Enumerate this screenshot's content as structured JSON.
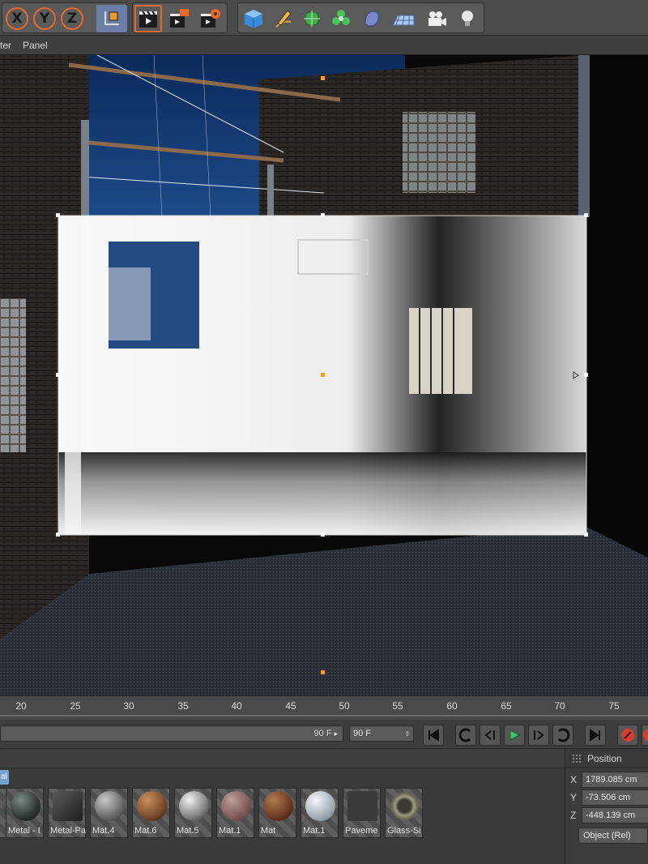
{
  "toolbar": {
    "axis_buttons": [
      "X",
      "Y",
      "Z"
    ],
    "icons": [
      "coordinate-system-icon",
      "render-view-icon",
      "render-to-picture-viewer-icon",
      "render-settings-icon",
      "cube-primitive-icon",
      "pen-spline-icon",
      "subdivision-icon",
      "cloner-icon",
      "deformer-icon",
      "floor-scene-icon",
      "camera-icon",
      "light-icon"
    ]
  },
  "menu": {
    "items": [
      "ter",
      "Panel"
    ]
  },
  "timeline": {
    "ticks": [
      "20",
      "25",
      "30",
      "35",
      "40",
      "45",
      "50",
      "55",
      "60",
      "65",
      "70",
      "75"
    ],
    "end_frame_field": "90 F",
    "end_frame_dropdown": "90 F"
  },
  "materials": {
    "tab_label": "al",
    "items": [
      {
        "label": "",
        "color": "#2e3530"
      },
      {
        "label": "Metal - I",
        "color": "#2f3634"
      },
      {
        "label": "Metal-Pa",
        "color": "#2a2a2a"
      },
      {
        "label": "Mat.4",
        "color": "#8a8a8a"
      },
      {
        "label": "Mat.6",
        "color": "#7a4a2a"
      },
      {
        "label": "Mat.5",
        "color": "#9a9a9a"
      },
      {
        "label": "Mat.1",
        "color": "#8a5a5a"
      },
      {
        "label": "Mat",
        "color": "#6a3a22"
      },
      {
        "label": "Mat.1",
        "color": "#aab4bc"
      },
      {
        "label": "Paveme",
        "color": "#3a3a3a"
      },
      {
        "label": "Glass-Si",
        "color": "#6a6a56"
      }
    ]
  },
  "coords": {
    "header": "Position",
    "x_label": "X",
    "x": "1789.085 cm",
    "y_label": "Y",
    "y": "-73.506 cm",
    "z_label": "Z",
    "z": "-448.139 cm",
    "mode": "Object (Rel)"
  },
  "colors": {
    "accent": "#e8692c",
    "play": "#3cc46a",
    "record": "#d83c30",
    "selection": "#f0a030"
  }
}
